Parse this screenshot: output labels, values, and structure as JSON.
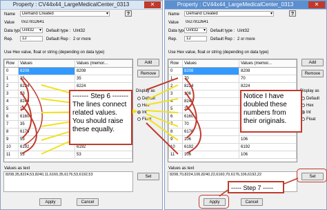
{
  "left": {
    "title": "Property : CV44x44_LargeMedicalCenter_0313",
    "close": "✕",
    "name_label": "Name",
    "name_value": "Demand Created",
    "value_label": "Value",
    "value_value": "0x27812641",
    "datatype_label": "Data type",
    "datatype_value": "Uint32",
    "default_type_label": "Default type :",
    "default_type_value": "Uint32",
    "rep_label": "Rep.",
    "rep_value": "12",
    "default_rep_label": "Default Rep :",
    "default_rep_value": "2 or more",
    "hint": "Use Hex value, float or string (depending on data type)",
    "columns": [
      "Row",
      "Values",
      "Values (memor..."
    ],
    "rows": [
      [
        "0",
        "8208",
        "8208"
      ],
      [
        "1",
        "35",
        "35"
      ],
      [
        "2",
        "8224",
        "8224"
      ],
      [
        "3",
        "53",
        "53"
      ],
      [
        "4",
        "8240",
        "8240"
      ],
      [
        "5",
        "11",
        "11"
      ],
      [
        "6",
        "6160",
        "6160"
      ],
      [
        "7",
        "35",
        "35"
      ],
      [
        "8",
        "6176",
        "6176"
      ],
      [
        "9",
        "53",
        "53"
      ],
      [
        "10",
        "6192",
        "6192"
      ],
      [
        "11",
        "53",
        "53"
      ]
    ],
    "add": "Add",
    "remove": "Remove",
    "display_as": "Display as",
    "radios": [
      "Default",
      "Hex",
      "Int",
      "Float"
    ],
    "selected_radio": "Int",
    "values_as_text_label": "Values as text",
    "values_as_text": "8208,35,8224,53,8240,11,6160,35,6176,53,6192,53",
    "set": "Set",
    "apply": "Apply",
    "cancel": "Cancel"
  },
  "right": {
    "title": "Property : CV44x44_LargeMedicalCenter_0313",
    "close": "✕",
    "name_label": "Name",
    "name_value": "Demand Created",
    "value_label": "Value",
    "value_value": "0x27812641",
    "datatype_label": "Data type",
    "datatype_value": "Uint32",
    "default_type_label": "Default type :",
    "default_type_value": "Uint32",
    "rep_label": "Rep.",
    "rep_value": "12",
    "default_rep_label": "Default Rep :",
    "default_rep_value": "2 or more",
    "hint": "Use Hex value, float or string (depending on data type)",
    "columns": [
      "Row",
      "Values",
      "Values (memor..."
    ],
    "rows": [
      [
        "0",
        "8208",
        "8208"
      ],
      [
        "1",
        "70",
        "70"
      ],
      [
        "2",
        "8224",
        "8224"
      ],
      [
        "3",
        "106",
        "106"
      ],
      [
        "4",
        "8240",
        "8240"
      ],
      [
        "5",
        "22",
        "22"
      ],
      [
        "6",
        "6160",
        "6160"
      ],
      [
        "7",
        "70",
        "70"
      ],
      [
        "8",
        "6176",
        "6176"
      ],
      [
        "9",
        "106",
        "106"
      ],
      [
        "10",
        "6192",
        "6192"
      ],
      [
        "11",
        "106",
        "106"
      ]
    ],
    "add": "Add",
    "remove": "Remove",
    "display_as": "Display as",
    "radios": [
      "Default",
      "Hex",
      "Int",
      "Float"
    ],
    "selected_radio": "Int",
    "values_as_text_label": "Values as text",
    "values_as_text": "8208,70,8224,106,8240,22,6160,70,6176,106,6192,22",
    "set": "Set",
    "apply": "Apply",
    "cancel": "Cancel"
  },
  "callouts": {
    "step6": "------- Step 6 ------- The lines connect related values. You should raise these equally.",
    "notice": "Notice I have doubled these numbers from their originals.",
    "step7": "----- Step 7 -----"
  },
  "colors": {
    "annotation_red": "#c0392b",
    "line_yellow": "#f1e21a",
    "selection_blue": "#3399ff"
  }
}
